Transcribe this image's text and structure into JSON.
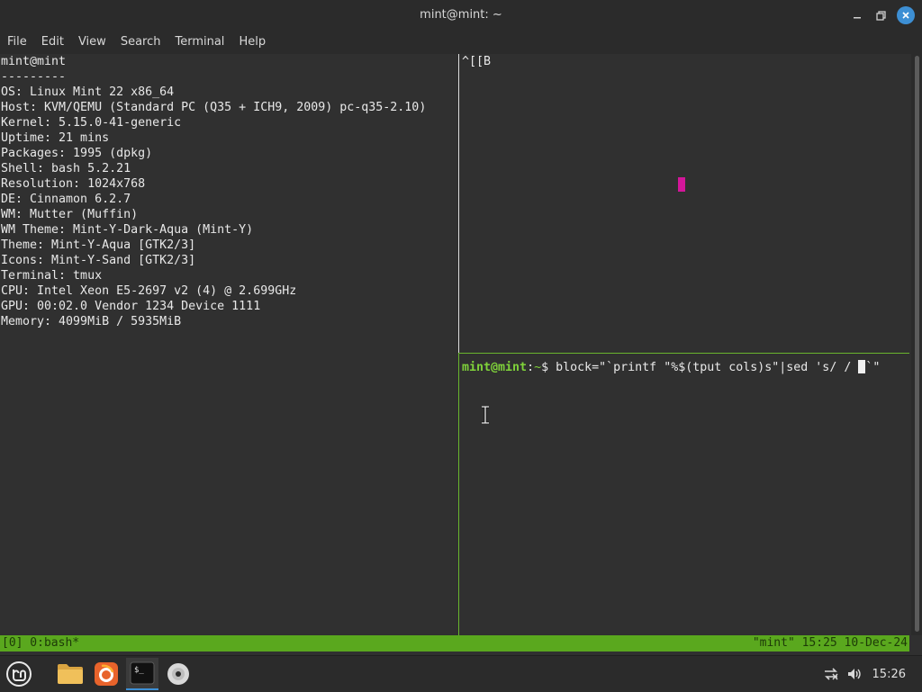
{
  "window": {
    "title": "mint@mint: ~"
  },
  "menubar": {
    "items": [
      "File",
      "Edit",
      "View",
      "Search",
      "Terminal",
      "Help"
    ]
  },
  "left_pane": {
    "lines": [
      "mint@mint",
      "---------",
      "OS: Linux Mint 22 x86_64",
      "Host: KVM/QEMU (Standard PC (Q35 + ICH9, 2009) pc-q35-2.10)",
      "Kernel: 5.15.0-41-generic",
      "Uptime: 21 mins",
      "Packages: 1995 (dpkg)",
      "Shell: bash 5.2.21",
      "Resolution: 1024x768",
      "DE: Cinnamon 6.2.7",
      "WM: Mutter (Muffin)",
      "WM Theme: Mint-Y-Dark-Aqua (Mint-Y)",
      "Theme: Mint-Y-Aqua [GTK2/3]",
      "Icons: Mint-Y-Sand [GTK2/3]",
      "Terminal: tmux",
      "CPU: Intel Xeon E5-2697 v2 (4) @ 2.699GHz",
      "GPU: 00:02.0 Vendor 1234 Device 1111",
      "Memory: 4099MiB / 5935MiB"
    ]
  },
  "top_right_pane": {
    "text": "^[[B"
  },
  "bottom_right_pane": {
    "prompt_user": "mint@mint",
    "prompt_sep": ":",
    "prompt_path": "~",
    "prompt_symbol": "$ ",
    "command": "block=\"`printf \"%$(tput cols)s\"|sed 's/ / ",
    "command_after_cursor": "`\""
  },
  "status_bar": {
    "left": "[0] 0:bash*",
    "right": "\"mint\" 15:25 10-Dec-24"
  },
  "taskbar": {
    "clock": "15:26"
  },
  "colors": {
    "status_bg": "#5aa81e",
    "prompt": "#7fd23a",
    "accent": "#3d8fd4",
    "marker": "#d3169a"
  }
}
